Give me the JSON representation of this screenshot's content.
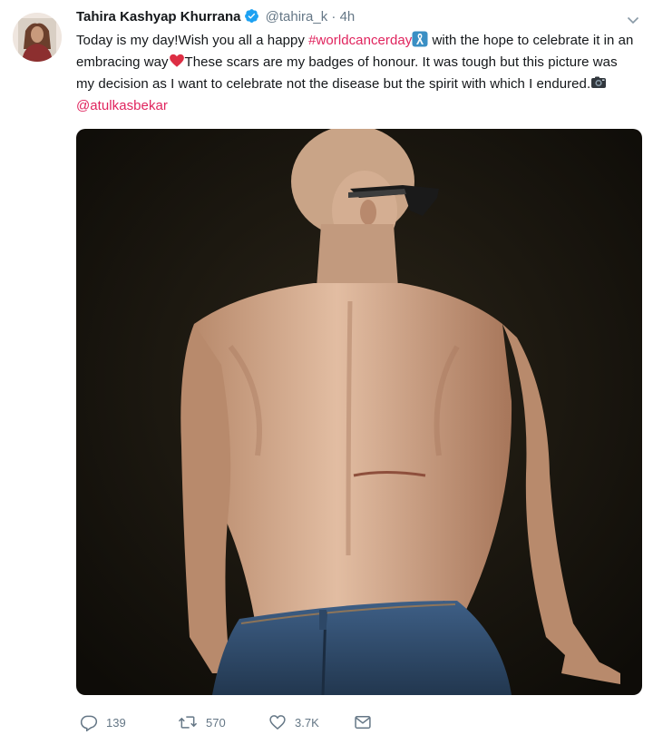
{
  "tweet": {
    "author": {
      "name": "Tahira Kashyap Khurrana",
      "handle": "@tahira_k",
      "separator": "·",
      "time": "4h",
      "avatar_icon": "profile-photo",
      "verified_icon": "verified-badge-icon"
    },
    "text": {
      "part1": "Today is my day!Wish you all a happy ",
      "hashtag": "#worldcancerday",
      "part2": " with the hope to celebrate it in an embracing way",
      "part3": "These scars are my badges of honour. It was tough but this picture was my decision as I want to celebrate not the disease but the spirit with which I endured.",
      "mention": "@atulkasbekar",
      "emoji_ribbon": "ribbon-emoji",
      "emoji_heart": "red-heart-emoji",
      "emoji_camera": "camera-emoji"
    },
    "media": {
      "description_icon": "tweet-photo"
    },
    "actions": {
      "replies": "139",
      "retweets": "570",
      "likes": "3.7K"
    },
    "colors": {
      "accent": "#e0245e",
      "text": "#14171a",
      "muted": "#657786",
      "verified": "#1da1f2"
    }
  }
}
